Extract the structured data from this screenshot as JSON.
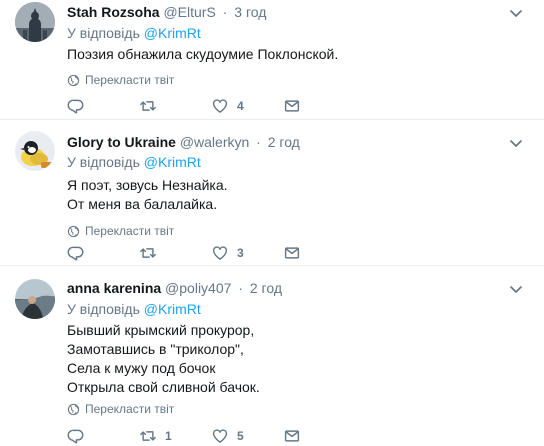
{
  "tweets": [
    {
      "name": "Stah Rozsoha",
      "handle": "@ElturS",
      "separator": "·",
      "time": "3 год",
      "reply_prefix": "У відповідь",
      "reply_mention": "@KrimRt",
      "text": "Поэзия обнажила скудоумие Поклонской.",
      "translate_label": "Перекласти твіт",
      "reply_count": "",
      "retweet_count": "",
      "like_count": "4"
    },
    {
      "name": "Glory to Ukraine",
      "handle": "@walerkyn",
      "separator": "·",
      "time": "2 год",
      "reply_prefix": "У відповідь",
      "reply_mention": "@KrimRt",
      "text": "Я поэт, зовусь Незнайка.\nОт меня ва балалайка.",
      "translate_label": "Перекласти твіт",
      "reply_count": "",
      "retweet_count": "",
      "like_count": "3"
    },
    {
      "name": "anna karenina",
      "handle": "@poliy407",
      "separator": "·",
      "time": "2 год",
      "reply_prefix": "У відповідь",
      "reply_mention": "@KrimRt",
      "text": "Бывший крымский прокурор,\nЗамотавшись в \"триколор\",\nСела к мужу под бочок\nОткрыла свой сливной бачок.",
      "translate_label": "Перекласти твіт",
      "reply_count": "",
      "retweet_count": "1",
      "like_count": "5"
    }
  ],
  "colors": {
    "text": "#14171a",
    "muted": "#657786",
    "link": "#1da1f2",
    "divider": "#e6ecf0"
  },
  "icons": {
    "reply": "reply-icon",
    "retweet": "retweet-icon",
    "like": "heart-icon",
    "message": "envelope-icon",
    "translate": "globe-icon",
    "menu": "chevron-down-icon"
  }
}
